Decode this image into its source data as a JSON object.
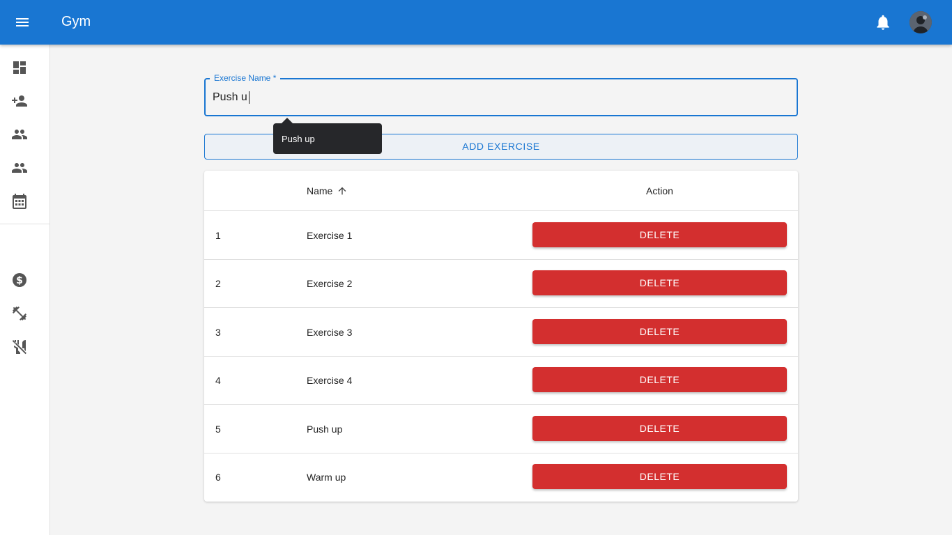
{
  "app": {
    "title": "Gym"
  },
  "header": {
    "menu_icon": "menu-icon",
    "notification_icon": "bell-icon",
    "avatar": "user-avatar"
  },
  "sidebar": {
    "items": [
      {
        "icon": "dashboard-icon"
      },
      {
        "icon": "person-add-icon"
      },
      {
        "icon": "people-icon"
      },
      {
        "icon": "people-icon"
      },
      {
        "icon": "calendar-icon"
      },
      {
        "icon": "dollar-icon"
      },
      {
        "icon": "fitness-icon"
      },
      {
        "icon": "no-meals-icon"
      }
    ]
  },
  "form": {
    "label": "Exercise Name *",
    "value": "Push u",
    "suggestion": "Push up",
    "submit_label": "ADD EXERCISE"
  },
  "table": {
    "columns": {
      "name": "Name",
      "action": "Action"
    },
    "rows": [
      {
        "id": "1",
        "name": "Exercise 1",
        "action": "DELETE"
      },
      {
        "id": "2",
        "name": "Exercise 2",
        "action": "DELETE"
      },
      {
        "id": "3",
        "name": "Exercise 3",
        "action": "DELETE"
      },
      {
        "id": "4",
        "name": "Exercise 4",
        "action": "DELETE"
      },
      {
        "id": "5",
        "name": "Push up",
        "action": "DELETE"
      },
      {
        "id": "6",
        "name": "Warm up",
        "action": "DELETE"
      }
    ]
  },
  "colors": {
    "primary": "#1976d2",
    "danger": "#d32f2f",
    "background": "#f4f4f4",
    "tooltip": "#26272a"
  }
}
